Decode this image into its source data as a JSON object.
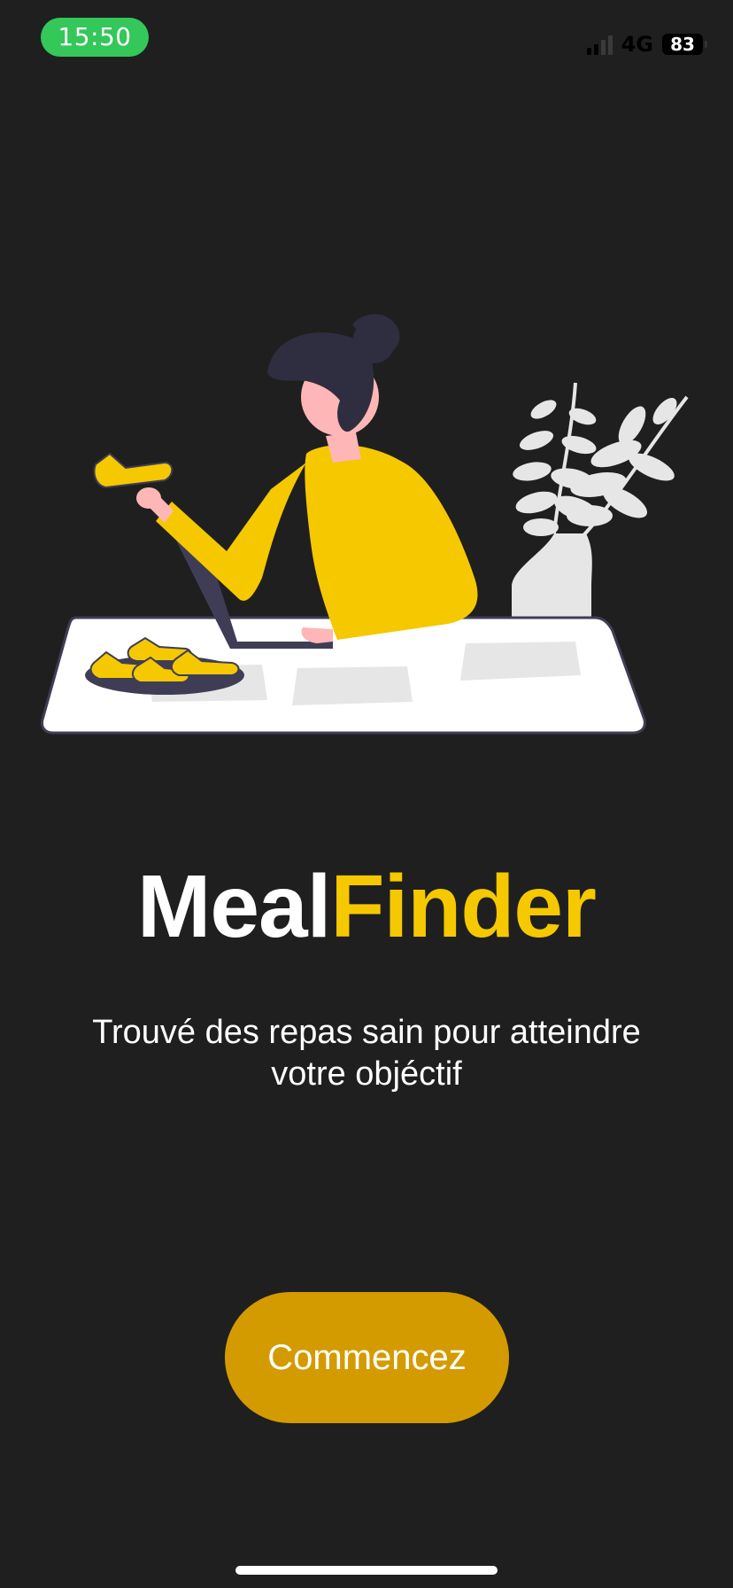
{
  "status_bar": {
    "time": "15:50",
    "network": "4G",
    "battery_level": "83",
    "signal_icon": "signal-bars-icon",
    "colors": {
      "time_pill": "#34c759"
    }
  },
  "illustration": {
    "subject": "woman-eating-at-desk-illustration",
    "colors": {
      "primary": "#f5c800",
      "dark": "#3f3d56",
      "skin": "#ffb6b6",
      "light": "#e6e6e6"
    }
  },
  "title": {
    "part_a": "Meal",
    "part_b": "Finder"
  },
  "tagline": "Trouvé des repas sain pour atteindre votre objéctif",
  "cta": {
    "label": "Commencez"
  },
  "theme": {
    "background": "#1f1f1f",
    "accent": "#f5c800",
    "button": "#d39b00"
  }
}
